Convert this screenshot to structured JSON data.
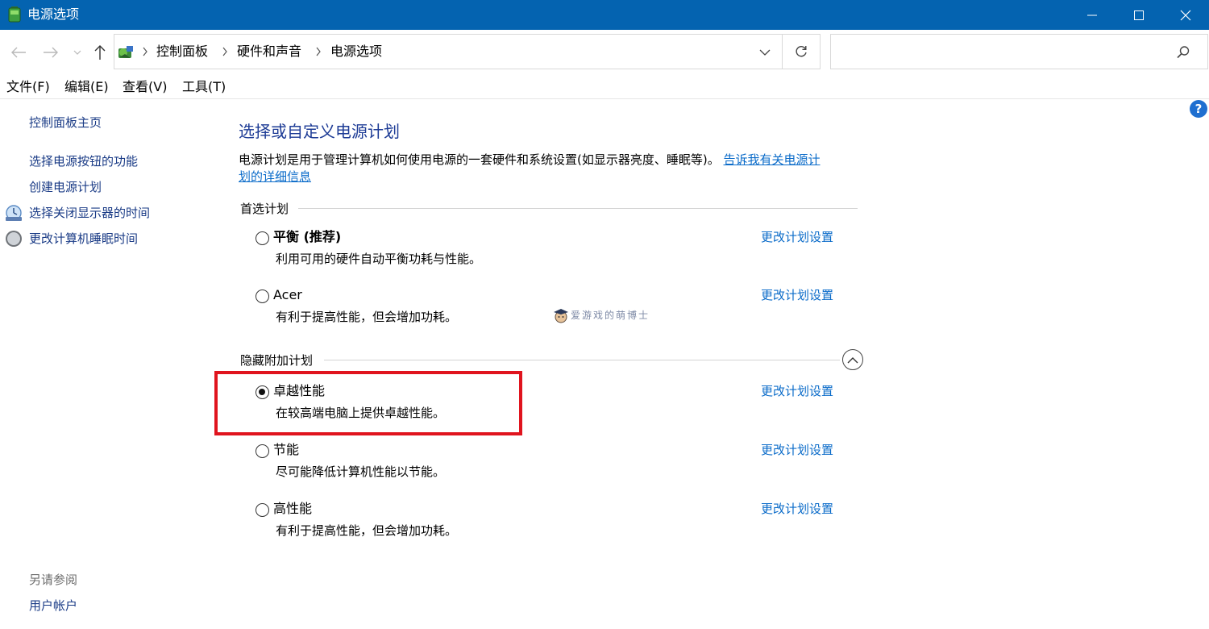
{
  "window": {
    "title": "电源选项",
    "minimize": "minimize",
    "maximize": "maximize",
    "close": "close"
  },
  "address": {
    "breadcrumbs": [
      "控制面板",
      "硬件和声音",
      "电源选项"
    ],
    "search_placeholder": ""
  },
  "menu": {
    "items": [
      "文件(F)",
      "编辑(E)",
      "查看(V)",
      "工具(T)"
    ]
  },
  "sidebar": {
    "home": "控制面板主页",
    "links": [
      "选择电源按钮的功能",
      "创建电源计划",
      "选择关闭显示器的时间",
      "更改计算机睡眠时间"
    ],
    "see_also_title": "另请参阅",
    "see_also_links": [
      "用户帐户"
    ]
  },
  "main": {
    "title": "选择或自定义电源计划",
    "description": "电源计划是用于管理计算机如何使用电源的一套硬件和系统设置(如显示器亮度、睡眠等)。",
    "description_link_line1": "告诉我有关电源计",
    "description_link_line2": "划的详细信息",
    "preferred_group": "首选计划",
    "hidden_group": "隐藏附加计划",
    "plan_link": "更改计划设置",
    "plans": [
      {
        "name": "平衡 (推荐)",
        "desc": "利用可用的硬件自动平衡功耗与性能。",
        "selected": false
      },
      {
        "name": "Acer",
        "desc": "有利于提高性能，但会增加功耗。",
        "selected": false
      },
      {
        "name": "卓越性能",
        "desc": "在较高端电脑上提供卓越性能。",
        "selected": true
      },
      {
        "name": "节能",
        "desc": "尽可能降低计算机性能以节能。",
        "selected": false
      },
      {
        "name": "高性能",
        "desc": "有利于提高性能，但会增加功耗。",
        "selected": false
      }
    ],
    "watermark": "爱游戏的萌博士"
  },
  "colors": {
    "titlebar": "#0463b0",
    "link": "#0a6bc9",
    "heading": "#1e3c96",
    "highlight": "#e0141e"
  }
}
